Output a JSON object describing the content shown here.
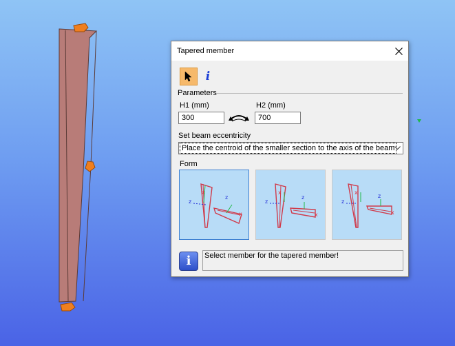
{
  "dialog": {
    "title": "Tapered member",
    "close_glyph": "✕",
    "tools": {
      "select_icon": "cursor-arrow-icon",
      "info_glyph": "i"
    },
    "parameters": {
      "heading": "Parameters",
      "h1_label": "H1 (mm)",
      "h1_value": "300",
      "h2_label": "H2 (mm)",
      "h2_value": "700"
    },
    "eccentricity": {
      "label": "Set beam eccentricity",
      "selected": "Place the centroid of the smaller section to the axis of the beam"
    },
    "form": {
      "heading": "Form",
      "options": [
        {
          "selected": true
        },
        {
          "selected": false
        },
        {
          "selected": false
        }
      ],
      "axis_labels": {
        "z": "z",
        "x": "x"
      }
    },
    "status": {
      "icon_glyph": "i",
      "message": "Select member for the tapered member!"
    }
  },
  "colors": {
    "beam_fill": "#b87c78",
    "handle": "#f07f1f",
    "selected_tool": "#f6b96b",
    "form_bg": "#b8dcf7",
    "axis_red": "#e0303a",
    "axis_green": "#20b848",
    "axis_blue": "#2330d8"
  }
}
